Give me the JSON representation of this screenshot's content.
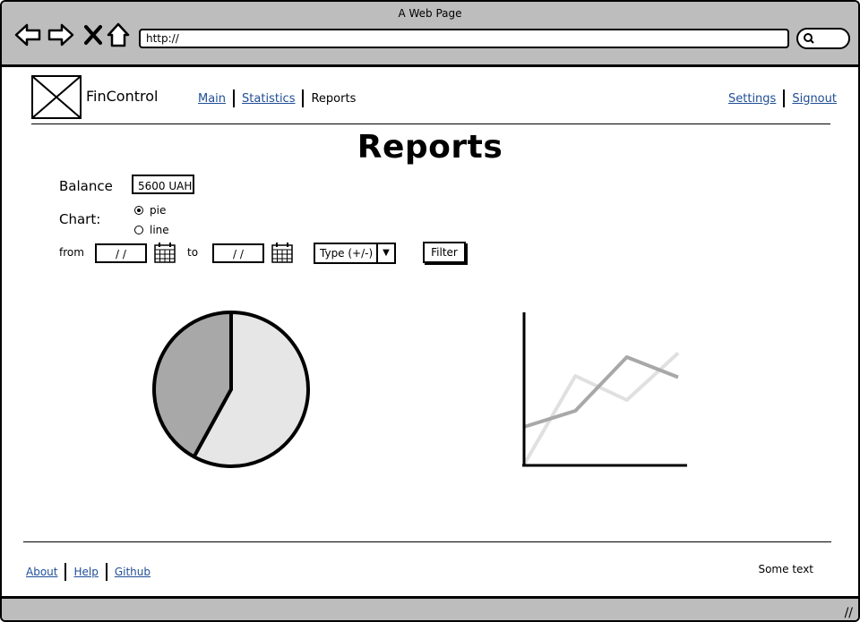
{
  "window": {
    "title": "A Web Page",
    "url": "http://"
  },
  "brand": "FinControl",
  "nav": {
    "main": "Main",
    "statistics": "Statistics",
    "reports": "Reports",
    "settings": "Settings",
    "signout": "Signout"
  },
  "page_title": "Reports",
  "balance": {
    "label": "Balance",
    "value": "5600 UAH"
  },
  "chart_type": {
    "label": "Chart:",
    "options": [
      "pie",
      "line"
    ],
    "selected": "pie"
  },
  "filter": {
    "from_label": "from",
    "from_value": "/ /",
    "to_label": "to",
    "to_value": "/ /",
    "type_value": "Type (+/-)",
    "button": "Filter"
  },
  "chart_data": [
    {
      "type": "pie",
      "slices": [
        {
          "value": 58,
          "color": "#e6e6e6"
        },
        {
          "value": 42,
          "color": "#a8a8a8"
        }
      ]
    },
    {
      "type": "line",
      "x": [
        0,
        1,
        2,
        3
      ],
      "series": [
        {
          "values": [
            0.28,
            0.4,
            0.8,
            0.65
          ],
          "color": "#a8a8a8"
        },
        {
          "values": [
            0.0,
            0.66,
            0.48,
            0.83
          ],
          "color": "#e0e0e0"
        }
      ],
      "ylim": [
        0,
        1
      ]
    }
  ],
  "footer": {
    "about": "About",
    "help": "Help",
    "github": "Github",
    "some_text": "Some text"
  }
}
